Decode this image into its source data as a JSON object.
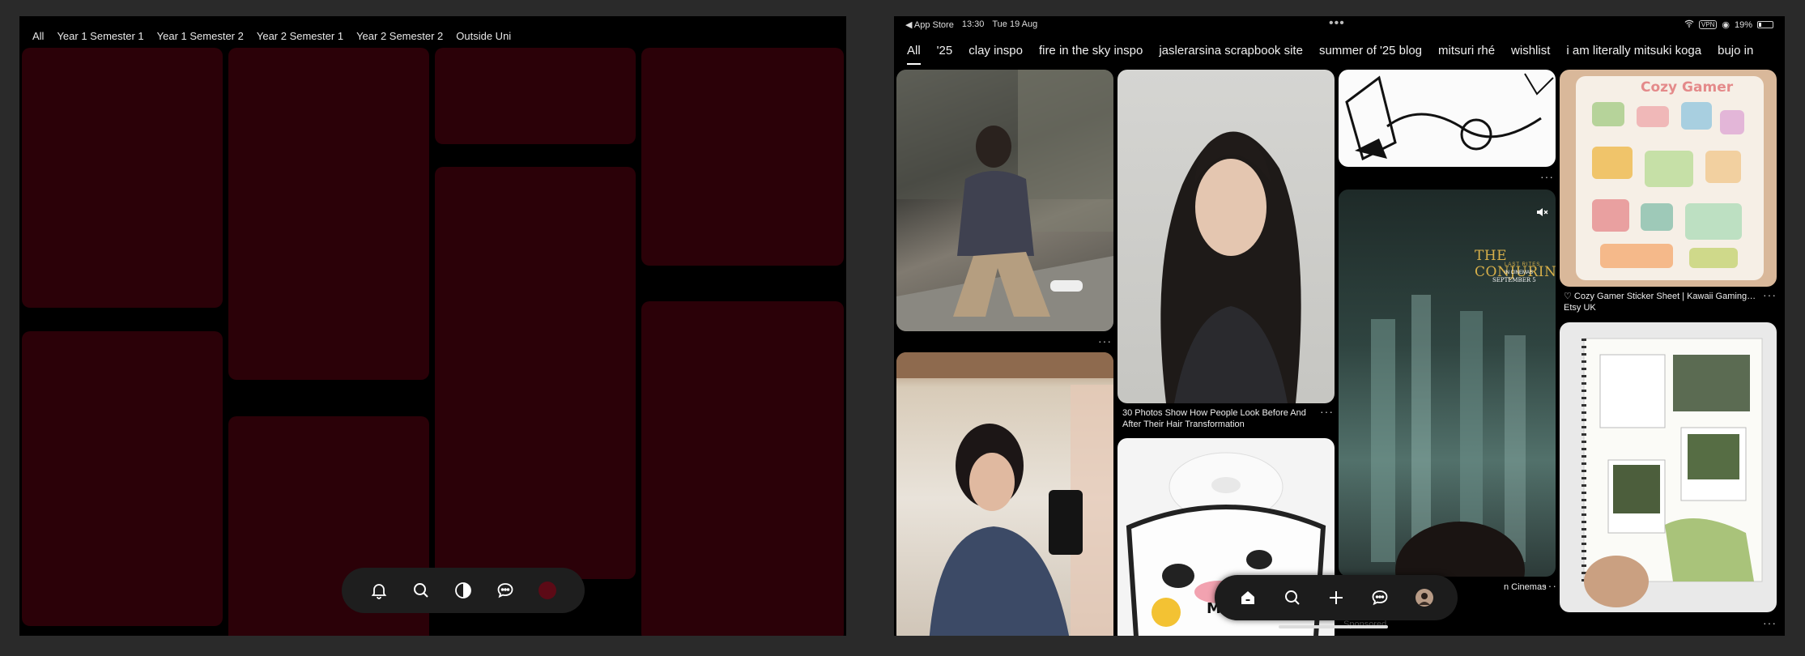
{
  "left": {
    "tabs": [
      "All",
      "Year 1 Semester 1",
      "Year 1 Semester 2",
      "Year 2 Semester 1",
      "Year 2 Semester 2",
      "Outside Uni"
    ],
    "card_color": "#2b0108",
    "dock_icons": [
      "bell-icon",
      "search-icon",
      "contrast-icon",
      "chat-icon",
      "avatar"
    ]
  },
  "right": {
    "status": {
      "back": "◀ App Store",
      "time": "13:30",
      "date": "Tue 19 Aug",
      "vpn": "VPN",
      "battery": "19%"
    },
    "tabs": [
      "All",
      "'25",
      "clay inspo",
      "fire in the sky inspo",
      "jaslerarsina scrapbook site",
      "summer of '25 blog",
      "mitsuri rhé",
      "wishlist",
      "i am literally mitsuki koga",
      "bujo in"
    ],
    "pins": {
      "hair_caption": "30 Photos Show How People Look Before And After Their Hair Transformation",
      "sticker_title": "♡ Cozy Gamer Sticker Sheet | Kawaii Gaming…",
      "sticker_source": "Etsy UK",
      "sticker_banner": "Cozy Gamer",
      "movie_caption": "n Cinemas",
      "movie_title": "THE CONJURING",
      "movie_sub": "LAST RITES",
      "movie_in": "IN CINEMAS",
      "movie_date": "SEPTEMBER 5",
      "sponsored": "Sponsored",
      "bowl_text": "MILK",
      "more": "···"
    },
    "dock_icons": [
      "home-icon",
      "search-icon",
      "plus-icon",
      "chat-icon",
      "profile-avatar"
    ]
  },
  "colors": {
    "accent_red": "#2b0108",
    "background": "#2a2a2a"
  }
}
